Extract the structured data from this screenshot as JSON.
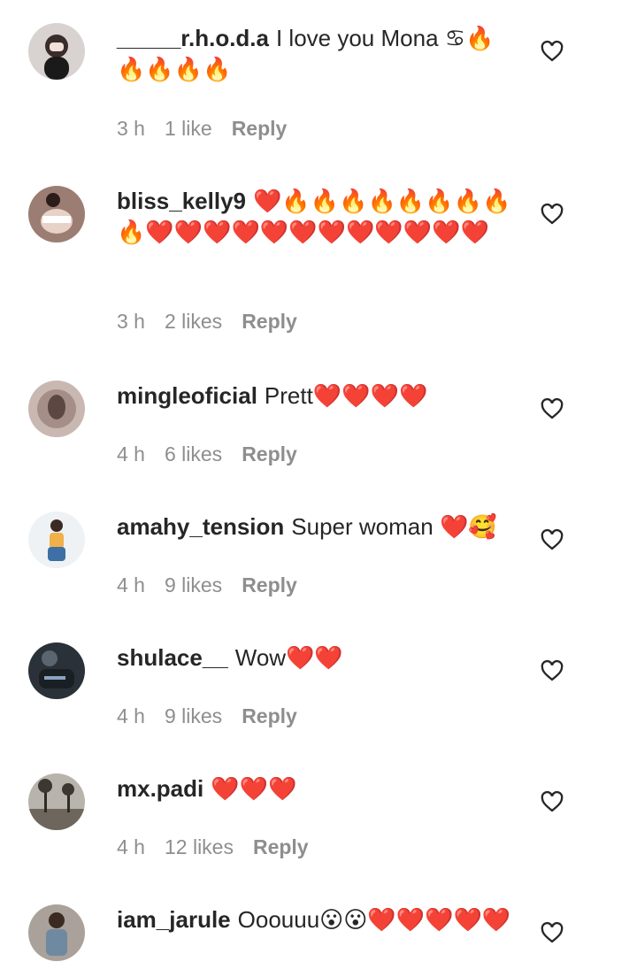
{
  "comments": [
    {
      "username": "_____r.h.o.d.a",
      "text": "I love you Mona ♋🔥🔥🔥🔥🔥",
      "time": "3 h",
      "likes": "1 like",
      "reply": "Reply"
    },
    {
      "username": "bliss_kelly9",
      "text": "❤️🔥🔥🔥🔥🔥🔥🔥🔥🔥❤️❤️❤️❤️❤️❤️❤️❤️❤️❤️❤️❤️",
      "time": "3 h",
      "likes": "2 likes",
      "reply": "Reply"
    },
    {
      "username": "mingleoficial",
      "text": "Prett❤️❤️❤️❤️",
      "time": "4 h",
      "likes": "6 likes",
      "reply": "Reply"
    },
    {
      "username": "amahy_tension",
      "text": "Super woman ❤️🥰",
      "time": "4 h",
      "likes": "9 likes",
      "reply": "Reply"
    },
    {
      "username": "shulace__",
      "text": "Wow❤️❤️",
      "time": "4 h",
      "likes": "9 likes",
      "reply": "Reply"
    },
    {
      "username": "mx.padi",
      "text": "❤️❤️❤️",
      "time": "4 h",
      "likes": "12 likes",
      "reply": "Reply"
    },
    {
      "username": "iam_jarule",
      "text": "Ooouuu😮😮❤️❤️❤️❤️❤️",
      "time": "",
      "likes": "",
      "reply": ""
    }
  ],
  "icons": {
    "like": "heart-outline-icon"
  }
}
